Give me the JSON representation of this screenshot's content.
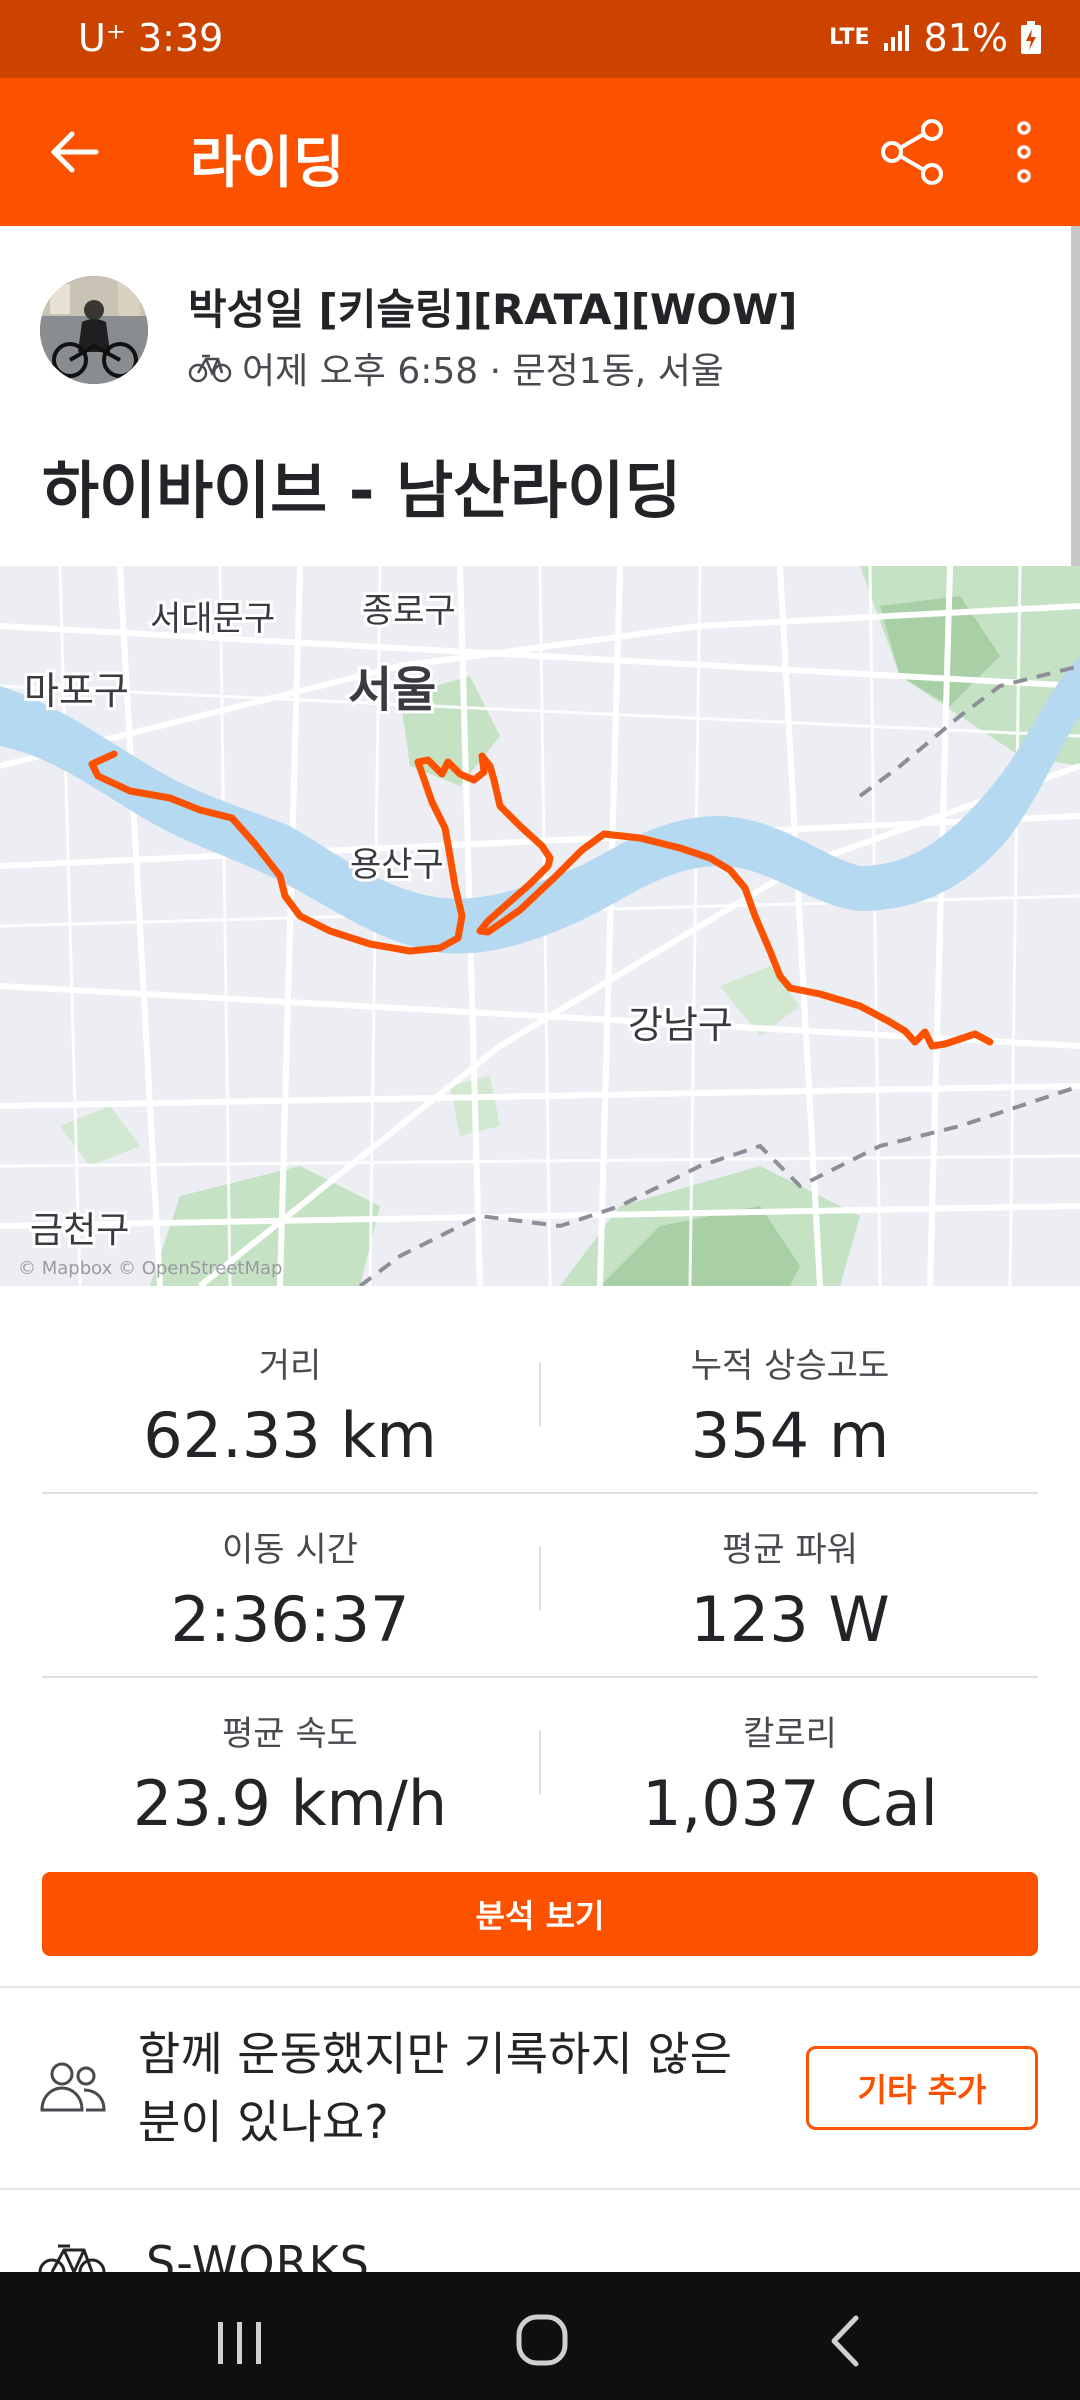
{
  "status_bar": {
    "carrier": "U⁺",
    "time": "3:39",
    "network": "LTE",
    "battery": "81%"
  },
  "app_bar": {
    "title": "라이딩",
    "icons": [
      "back-arrow-icon",
      "share-icon",
      "more-vertical-icon"
    ]
  },
  "header": {
    "athlete_name": "박성일 [키슬링][RATA][WOW]",
    "meta": "어제 오후 6:58 · 문정1동, 서울",
    "activity_title": "하이바이브 - 남산라이딩"
  },
  "map": {
    "labels": {
      "mapo": "마포구",
      "seodaemun": "서대문구",
      "jongno": "종로구",
      "seoul": "서울",
      "yongsan": "용산구",
      "gangnam": "강남구",
      "geumcheon": "금천구"
    },
    "attribution": "© Mapbox © OpenStreetMap",
    "route_color": "#fc5200"
  },
  "stats": [
    {
      "label": "거리",
      "value": "62.33 km"
    },
    {
      "label": "누적 상승고도",
      "value": "354 m"
    },
    {
      "label": "이동 시간",
      "value": "2:36:37"
    },
    {
      "label": "평균 파워",
      "value": "123 W"
    },
    {
      "label": "평균 속도",
      "value": "23.9 km/h"
    },
    {
      "label": "칼로리",
      "value": "1,037 Cal"
    }
  ],
  "analyze_button": "분석 보기",
  "together": {
    "prompt": "함께 운동했지만 기록하지 않은 분이 있나요?",
    "button": "기타 추가"
  },
  "gear": {
    "name": "S-WORKS"
  },
  "colors": {
    "brand": "#fc5200",
    "status_bar": "#cc4300"
  }
}
